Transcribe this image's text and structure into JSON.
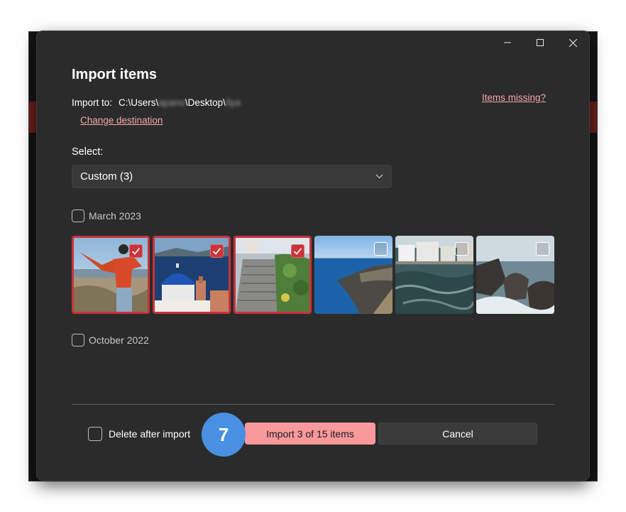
{
  "dialog": {
    "title": "Import items",
    "import_to_label": "Import to:",
    "path": {
      "prefix": "C:\\Users\\",
      "user_redacted": "apano",
      "middle": "\\Desktop\\",
      "folder_redacted": "Ilya"
    },
    "change_destination": "Change destination",
    "items_missing": "Items missing?",
    "select_label": "Select:",
    "select_value": "Custom (3)",
    "groups": [
      {
        "label": "March 2023",
        "checked": false
      },
      {
        "label": "October 2022",
        "checked": false
      }
    ],
    "thumbnails": [
      {
        "name": "thumb-man-arms-outstretched",
        "selected": true
      },
      {
        "name": "thumb-blue-dome-church",
        "selected": true
      },
      {
        "name": "thumb-stone-stairs",
        "selected": true
      },
      {
        "name": "thumb-caldera-cliffs",
        "selected": false
      },
      {
        "name": "thumb-harbor-waves",
        "selected": false
      },
      {
        "name": "thumb-rocky-shore",
        "selected": false
      }
    ],
    "delete_after_import": "Delete after import",
    "import_button": "Import 3 of 15 items",
    "cancel_button": "Cancel",
    "step_badge": "7"
  },
  "colors": {
    "dialog_bg": "#2b2b2b",
    "accent": "#f9999c",
    "selection": "#c9333a",
    "link": "#f4a8a8",
    "badge": "#4a90e2"
  },
  "icons": {
    "minimize": "minimize-icon",
    "maximize": "maximize-icon",
    "close": "close-icon",
    "dropdown": "chevron-down-icon",
    "check": "checkmark-icon"
  }
}
